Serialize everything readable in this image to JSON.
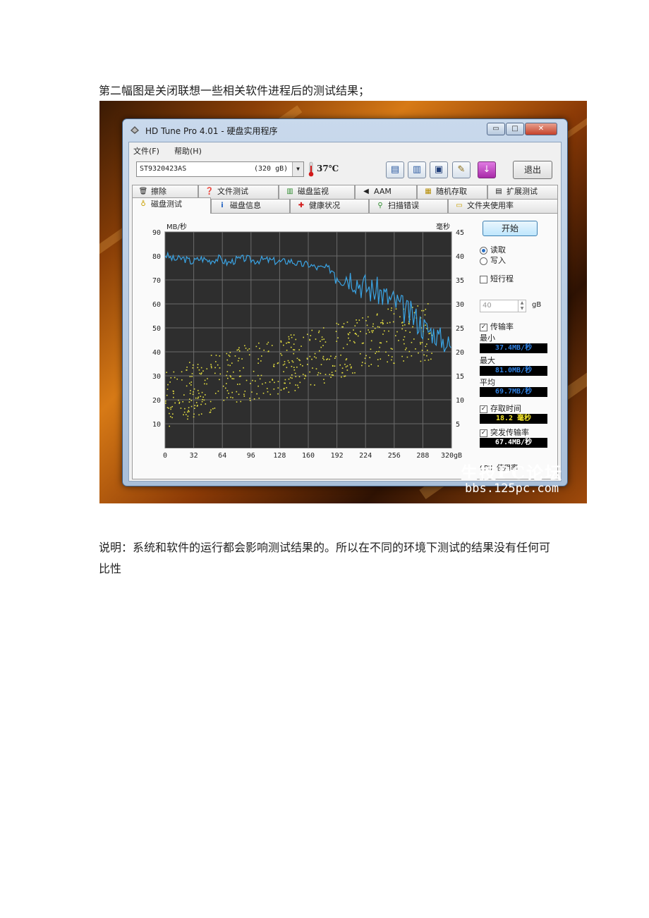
{
  "document": {
    "intro": "第二幅图是关闭联想一些相关软件进程后的测试结果；",
    "note": "说明：系统和软件的运行都会影响测试结果的。所以在不同的环境下测试的结果没有任何可比性"
  },
  "window": {
    "title": "HD Tune Pro 4.01 - 硬盘实用程序",
    "minimize_symbol": "▭",
    "maximize_symbol": "□",
    "close_symbol": "✕"
  },
  "menu": {
    "file": "文件(F)",
    "help": "帮助(H)"
  },
  "toolbar": {
    "drive_name": "ST9320423AS",
    "drive_size": "(320 gB)",
    "temperature": "37℃",
    "exit_label": "退出",
    "icons": [
      "copy-text-icon",
      "copy-image-icon",
      "save-icon",
      "options-icon",
      "download-icon"
    ]
  },
  "tabs": {
    "row1": [
      {
        "label": "擦除",
        "icon": "trash-icon"
      },
      {
        "label": "文件测试",
        "icon": "file-test-icon"
      },
      {
        "label": "磁盘监视",
        "icon": "monitor-icon"
      },
      {
        "label": "AAM",
        "icon": "speaker-icon"
      },
      {
        "label": "随机存取",
        "icon": "random-access-icon"
      },
      {
        "label": "扩展测试",
        "icon": "extra-tests-icon"
      }
    ],
    "row2": [
      {
        "label": "磁盘测试",
        "icon": "bulb-icon",
        "active": true
      },
      {
        "label": "磁盘信息",
        "icon": "info-icon"
      },
      {
        "label": "健康状况",
        "icon": "health-cross-icon"
      },
      {
        "label": "扫描错误",
        "icon": "magnifier-icon"
      },
      {
        "label": "文件夹使用率",
        "icon": "folder-icon"
      }
    ]
  },
  "panel": {
    "start_label": "开始",
    "read_label": "读取",
    "write_label": "写入",
    "short_stroke_label": "短行程",
    "block_size_value": "40",
    "block_size_unit": "gB",
    "transfer_rate_label": "传输率",
    "min_label": "最小",
    "min_value": "37.4MB/秒",
    "max_label": "最大",
    "max_value": "81.0MB/秒",
    "avg_label": "平均",
    "avg_value": "69.7MB/秒",
    "access_time_label": "存取时间",
    "access_time_value": "18.2 毫秒",
    "burst_rate_label": "突发传输率",
    "burst_rate_value": "67.4MB/秒",
    "cpu_label": "CPU 使用率"
  },
  "chart_data": {
    "type": "line",
    "y_left_label": "MB/秒",
    "y_right_label": "毫秒",
    "x_ticks": [
      "0",
      "32",
      "64",
      "96",
      "128",
      "160",
      "192",
      "224",
      "256",
      "288",
      "320gB"
    ],
    "y_left_ticks": [
      "90",
      "80",
      "70",
      "60",
      "50",
      "40",
      "30",
      "20",
      "10"
    ],
    "y_right_ticks": [
      "45",
      "40",
      "35",
      "30",
      "25",
      "20",
      "15",
      "10",
      "5"
    ],
    "xlim": [
      0,
      320
    ],
    "ylim_left": [
      0,
      90
    ],
    "ylim_right": [
      0,
      45
    ],
    "grid": true,
    "colors": {
      "transfer": "#3aa3e3",
      "access": "#e6e040",
      "background": "#2e2e2e",
      "grid": "#6a6a6a"
    },
    "series": [
      {
        "name": "传输率",
        "axis": "left",
        "x": [
          0,
          10,
          20,
          30,
          40,
          50,
          60,
          70,
          80,
          90,
          100,
          110,
          120,
          130,
          140,
          150,
          160,
          170,
          180,
          190,
          200,
          210,
          220,
          230,
          240,
          250,
          260,
          270,
          280,
          290,
          300,
          310,
          320
        ],
        "values": [
          80.5,
          78.5,
          79,
          77.5,
          79,
          78,
          79,
          77,
          78.5,
          79,
          78,
          78.5,
          78,
          77.5,
          78,
          76.5,
          76.5,
          75,
          75,
          73.5,
          72.5,
          71,
          68,
          66,
          65,
          62,
          60,
          56.5,
          54,
          50,
          48,
          45,
          42
        ]
      },
      {
        "name": "存取时间",
        "axis": "right",
        "approximate_band": true,
        "x": [
          0,
          40,
          80,
          120,
          160,
          200,
          240,
          280,
          320
        ],
        "values": [
          10,
          13,
          15,
          17,
          18.5,
          21,
          23,
          24,
          25
        ]
      }
    ]
  },
  "watermark": {
    "cn": "生技PC论坛",
    "url": "bbs.125pc.com"
  }
}
